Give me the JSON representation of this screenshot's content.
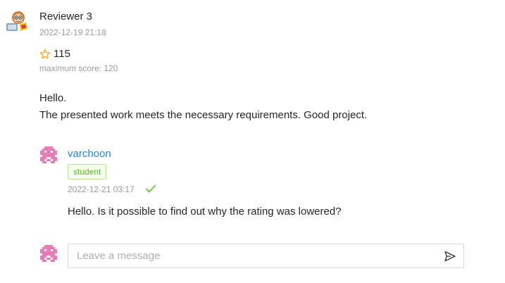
{
  "review": {
    "reviewer_name": "Reviewer 3",
    "timestamp": "2022-12-19 21:18",
    "score": "115",
    "max_score_text": "maximum score: 120",
    "text_lines": [
      "Hello.",
      "The presented work meets the necessary requirements. Good project."
    ],
    "star_color": "#f5a623"
  },
  "reply": {
    "author": "varchoon",
    "role_badge": "student",
    "timestamp": "2022-12-21 03:17",
    "text": "Hello. Is it possible to find out why the rating was lowered?",
    "author_color": "#1e88e5",
    "check_color": "#52c41a"
  },
  "composer": {
    "placeholder": "Leave a message"
  },
  "icons": {
    "reviewer_avatar": "reviewer-avatar-icon",
    "user_avatar": "pixel-avatar-icon",
    "star": "star-outline-icon",
    "check": "check-icon",
    "send": "send-icon"
  }
}
